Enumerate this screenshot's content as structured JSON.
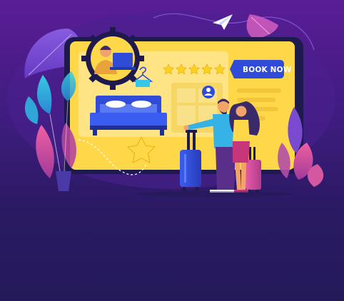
{
  "booking_screen": {
    "book_now_label": "BOOK NOW",
    "rating_stars": 5
  },
  "colors": {
    "background_top": "#5a1d96",
    "background_bottom": "#241a5a",
    "screen_yellow": "#ffd84a",
    "accent_blue": "#2f4bd8",
    "accent_pink": "#e0609e",
    "star_yellow": "#ffd84a"
  },
  "icons": [
    "support-agent-icon",
    "hanger-icon",
    "bed-icon",
    "user-avatar-icon",
    "paper-plane-icon",
    "star-icon"
  ]
}
